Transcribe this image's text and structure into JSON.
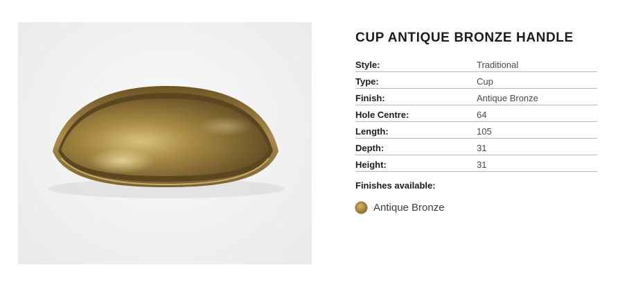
{
  "product": {
    "title": "CUP ANTIQUE BRONZE HANDLE"
  },
  "specs": [
    {
      "label": "Style:",
      "value": "Traditional"
    },
    {
      "label": "Type:",
      "value": "Cup"
    },
    {
      "label": "Finish:",
      "value": "Antique Bronze"
    },
    {
      "label": "Hole Centre:",
      "value": "64"
    },
    {
      "label": "Length:",
      "value": "105"
    },
    {
      "label": "Depth:",
      "value": "31"
    },
    {
      "label": "Height:",
      "value": "31"
    }
  ],
  "finishes": {
    "heading": "Finishes available:",
    "items": [
      {
        "label": "Antique Bronze",
        "swatch_color": "#a8853a"
      }
    ]
  }
}
